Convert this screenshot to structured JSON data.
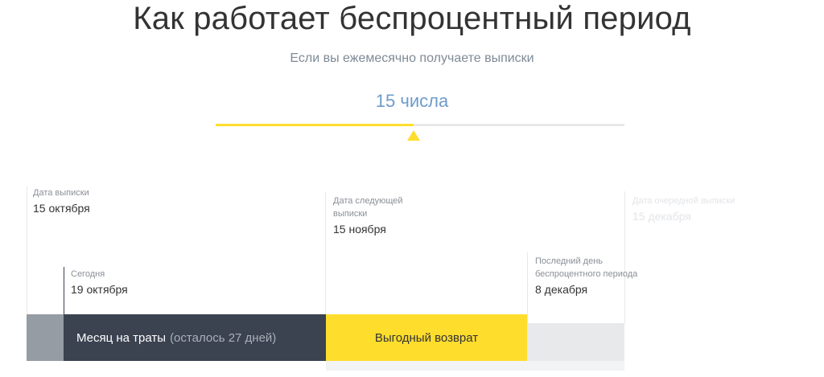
{
  "title": "Как работает беспроцентный период",
  "subtitle": "Если вы ежемесячно получаете выписки",
  "selected_day": "15 числа",
  "slider": {
    "fill_fraction": 0.484
  },
  "timeline": {
    "statement_date": {
      "label": "Дата выписки",
      "date": "15 октября"
    },
    "today": {
      "label": "Сегодня",
      "date": "19 октября"
    },
    "next_statement": {
      "label_line1": "Дата следующей",
      "label_line2": "выписки",
      "date": "15 ноября"
    },
    "last_grace_day": {
      "label_line1": "Последний день",
      "label_line2": "беспроцентного периода",
      "date": "8 декабря"
    },
    "following_statement": {
      "label": "Дата очередной выписки",
      "date": "15 декабря"
    }
  },
  "bars": {
    "spending_month": "Месяц на траты",
    "remaining": "(осталось 27 дней)",
    "repayment": "Выгодный возврат"
  },
  "colors": {
    "accent_yellow": "#ffdd2d",
    "dark_bar": "#3b4250",
    "grey_bar": "#969ca3",
    "light_bar": "#e8e9ea",
    "day_value": "#6f9bcb"
  }
}
